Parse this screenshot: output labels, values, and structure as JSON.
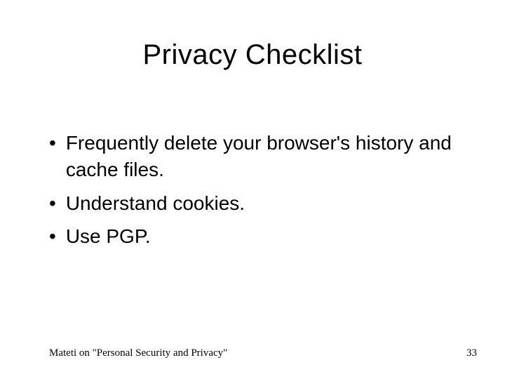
{
  "title": "Privacy Checklist",
  "bullets": [
    {
      "text": "Frequently delete your browser's history and cache files."
    },
    {
      "text": "Understand cookies."
    },
    {
      "text": "Use PGP."
    }
  ],
  "footer": {
    "left": "Mateti on \"Personal Security and Privacy\"",
    "right": "33"
  }
}
